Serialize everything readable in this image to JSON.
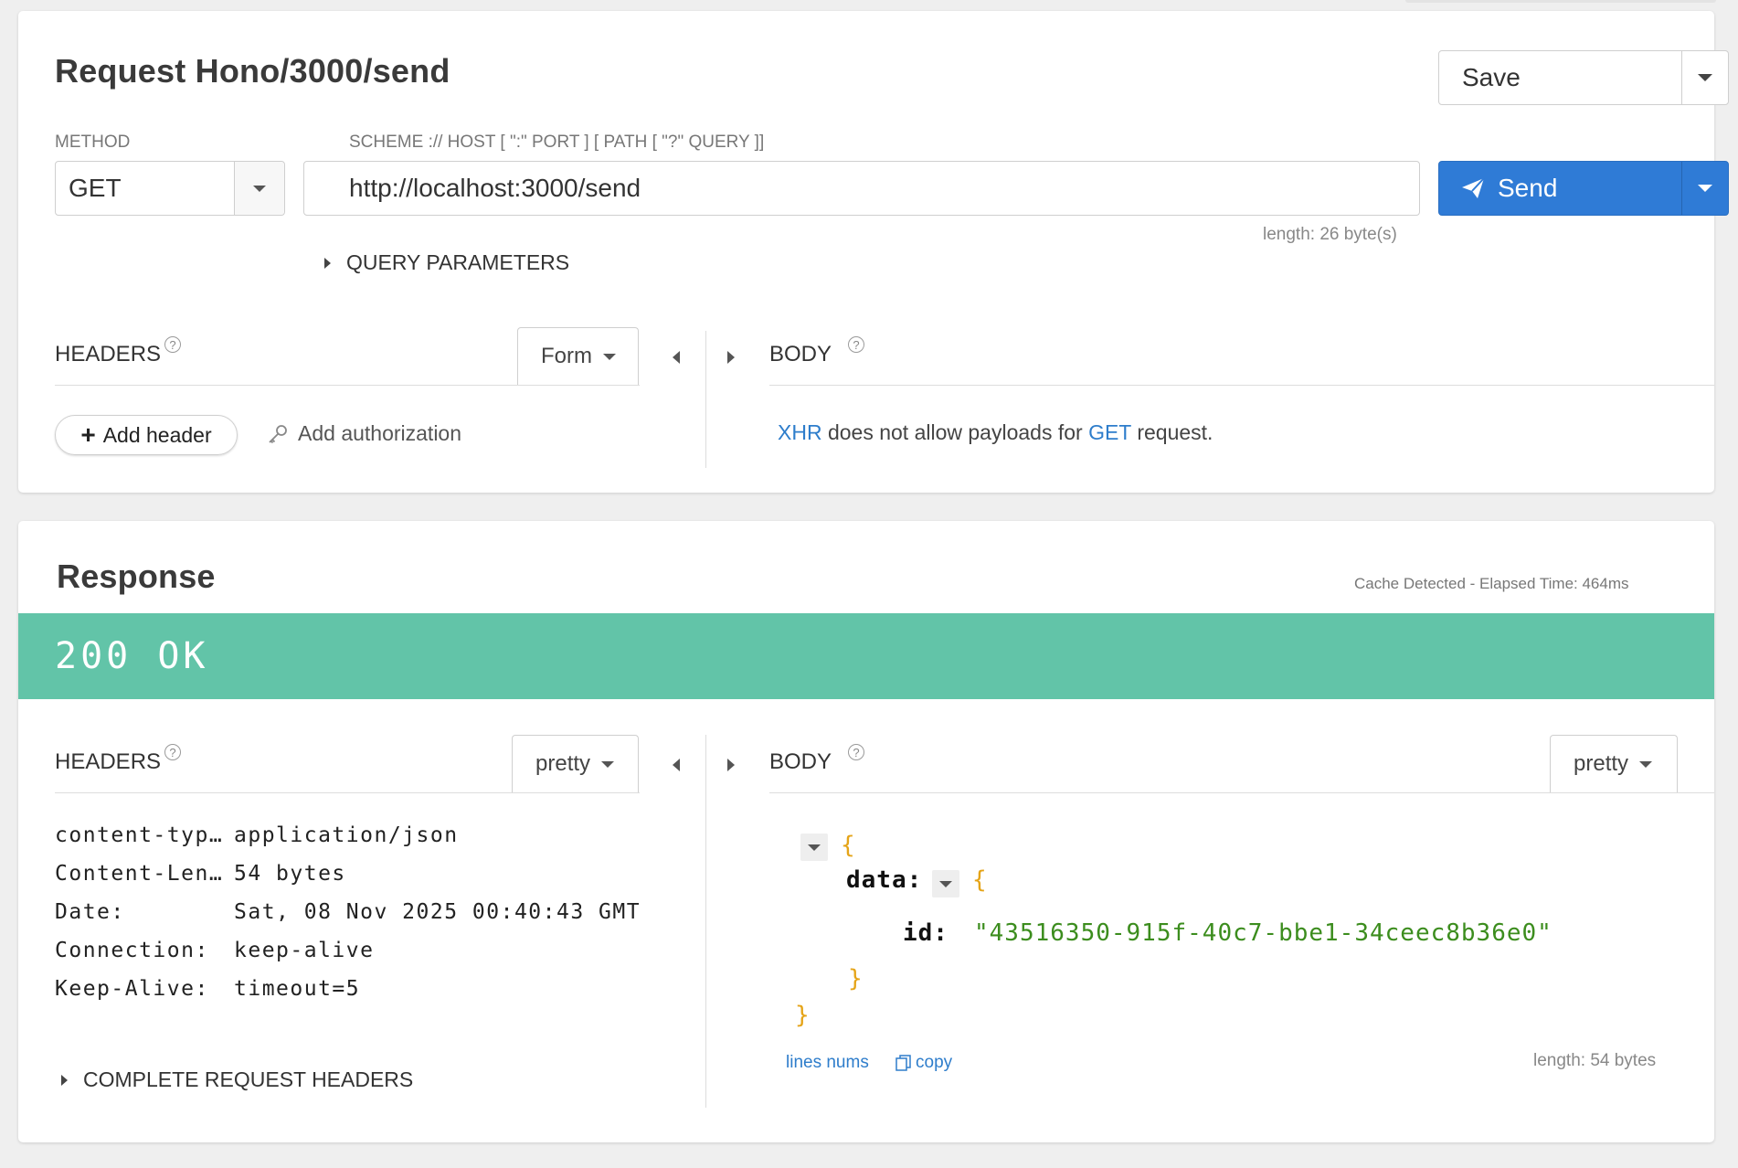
{
  "request": {
    "title": "Request Hono/3000/send",
    "save_label": "Save",
    "method_label": "METHOD",
    "method_value": "GET",
    "url_label": "SCHEME :// HOST [ \":\" PORT ] [ PATH [ \"?\" QUERY ]]",
    "url_value": "http://localhost:3000/send",
    "url_length": "length: 26 byte(s)",
    "send_label": "Send",
    "query_params_label": "QUERY PARAMETERS",
    "headers_label": "HEADERS",
    "headers_mode": "Form",
    "body_label": "BODY",
    "add_header_label": "Add header",
    "add_auth_label": "Add authorization",
    "body_message": {
      "xhr": "XHR",
      "middle": " does not allow payloads for ",
      "method": "GET",
      "end": " request."
    }
  },
  "response": {
    "title": "Response",
    "cache_status": "Cache Detected -",
    "elapsed": "Elapsed Time: 464ms",
    "status_text": "200 OK",
    "status_color": "#62c4a8",
    "headers_label": "HEADERS",
    "headers_mode": "pretty",
    "body_label": "BODY",
    "body_mode": "pretty",
    "headers": [
      {
        "key": "content-type:",
        "value": "application/json"
      },
      {
        "key": "Content-Leng…",
        "value": "54 bytes"
      },
      {
        "key": "Date:",
        "value": "Sat, 08 Nov 2025 00:40:43 GMT"
      },
      {
        "key": "Connection:",
        "value": "keep-alive"
      },
      {
        "key": "Keep-Alive:",
        "value": "timeout=5"
      }
    ],
    "complete_request_headers_label": "COMPLETE REQUEST HEADERS",
    "json": {
      "open_brace": "{",
      "data_key": "data:",
      "inner_open": "{",
      "id_key": "id:",
      "id_value": "\"43516350-915f-40c7-bbe1-34ceec8b36e0\"",
      "inner_close": "}",
      "close_brace": "}"
    },
    "lines_nums_label": "lines nums",
    "copy_label": "copy",
    "body_length": "length: 54 bytes"
  },
  "colors": {
    "accent": "#2e7dcb",
    "send_button": "#2f7bd6",
    "status_ok": "#62c4a8",
    "json_string": "#3c8d1e",
    "json_brace": "#e5a418"
  }
}
